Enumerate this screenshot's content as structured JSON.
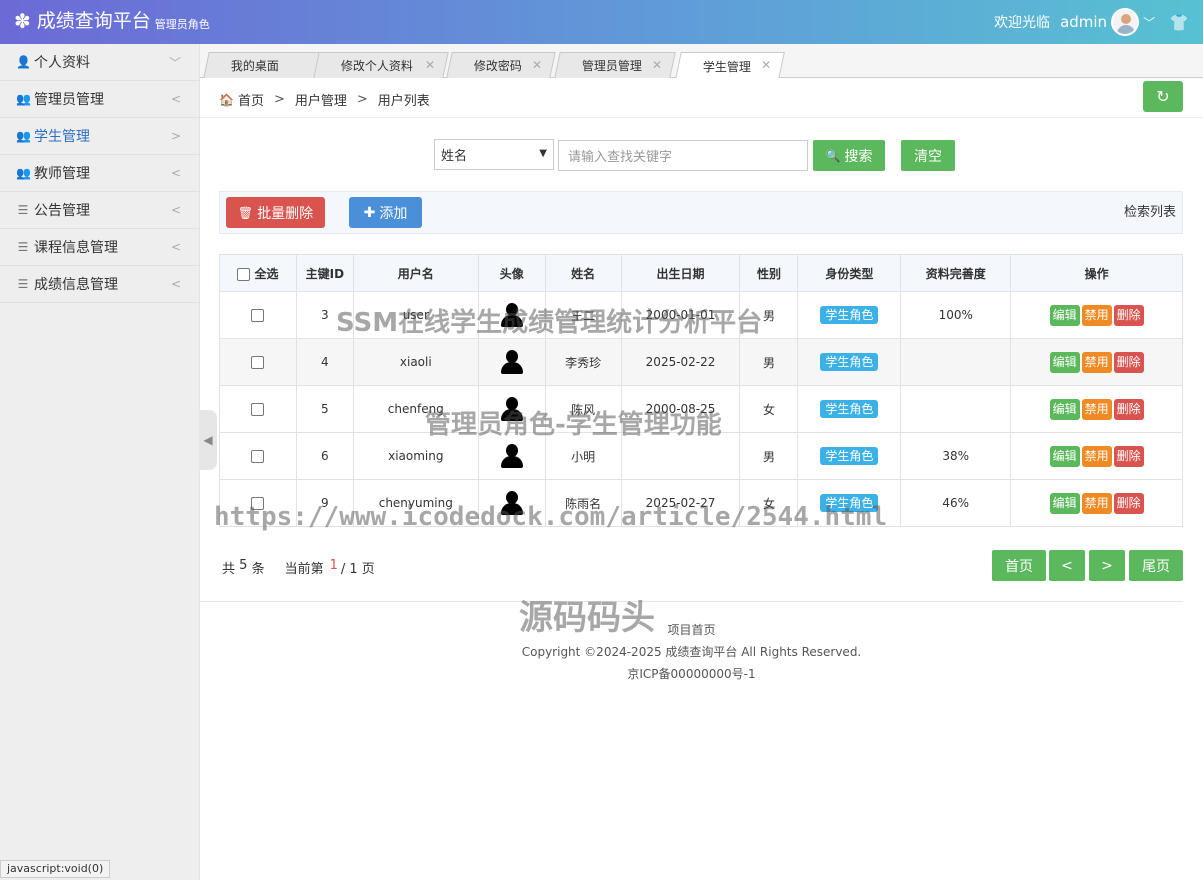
{
  "header": {
    "title": "成绩查询平台",
    "role": "管理员角色",
    "welcome": "欢迎光临",
    "username": "admin"
  },
  "sidebar": {
    "items": [
      {
        "label": "个人资料",
        "icon": "user-icon",
        "arrow": "﹀"
      },
      {
        "label": "管理员管理",
        "icon": "users-icon",
        "arrow": "<"
      },
      {
        "label": "学生管理",
        "icon": "users-icon",
        "arrow": ">"
      },
      {
        "label": "教师管理",
        "icon": "users-icon",
        "arrow": "<"
      },
      {
        "label": "公告管理",
        "icon": "list-icon",
        "arrow": "<"
      },
      {
        "label": "课程信息管理",
        "icon": "list-icon",
        "arrow": "<"
      },
      {
        "label": "成绩信息管理",
        "icon": "list-icon",
        "arrow": "<"
      }
    ],
    "active_index": 2
  },
  "tabs": [
    {
      "label": "我的桌面",
      "closable": false
    },
    {
      "label": "修改个人资料",
      "closable": true
    },
    {
      "label": "修改密码",
      "closable": true
    },
    {
      "label": "管理员管理",
      "closable": true
    },
    {
      "label": "学生管理",
      "closable": true
    }
  ],
  "active_tab": 4,
  "breadcrumb": [
    "首页",
    "用户管理",
    "用户列表"
  ],
  "search": {
    "field": "姓名",
    "placeholder": "请输入查找关键字",
    "search_label": "搜索",
    "clear_label": "清空"
  },
  "toolbar": {
    "bulk_delete_label": "批量删除",
    "add_label": "添加",
    "title": "检索列表"
  },
  "table": {
    "headers": [
      "全选",
      "主键ID",
      "用户名",
      "头像",
      "姓名",
      "出生日期",
      "性别",
      "身份类型",
      "资料完善度",
      "操作"
    ],
    "rows": [
      {
        "id": "3",
        "username": "user",
        "name": "王二",
        "birth": "2000-01-01",
        "gender": "男",
        "role": "学生角色",
        "completion": "100%"
      },
      {
        "id": "4",
        "username": "xiaoli",
        "name": "李秀珍",
        "birth": "2025-02-22",
        "gender": "男",
        "role": "学生角色",
        "completion": ""
      },
      {
        "id": "5",
        "username": "chenfeng",
        "name": "陈风",
        "birth": "2000-08-25",
        "gender": "女",
        "role": "学生角色",
        "completion": ""
      },
      {
        "id": "6",
        "username": "xiaoming",
        "name": "小明",
        "birth": "",
        "gender": "男",
        "role": "学生角色",
        "completion": "38%"
      },
      {
        "id": "9",
        "username": "chenyuming",
        "name": "陈雨名",
        "birth": "2025-02-27",
        "gender": "女",
        "role": "学生角色",
        "completion": "46%"
      }
    ],
    "actions": {
      "edit": "编辑",
      "disable": "禁用",
      "delete": "删除"
    }
  },
  "pagination": {
    "total_prefix": "共",
    "total": "5",
    "total_suffix": "条",
    "current_prefix": "当前第",
    "current": "1",
    "pages": "/ 1 页",
    "first": "首页",
    "prev": "<",
    "next": ">",
    "last": "尾页"
  },
  "footer": {
    "link": "项目首页",
    "copyright": "Copyright ©2024-2025 成绩查询平台 All Rights Reserved.",
    "icp": "京ICP备00000000号-1"
  },
  "status_bar": "javascript:void(0)",
  "watermarks": {
    "title": "SSM在线学生成绩管理统计分析平台",
    "subtitle": "管理员角色-学生管理功能",
    "url": "https://www.icodedock.com/article/2544.html",
    "brand": "源码码头"
  }
}
